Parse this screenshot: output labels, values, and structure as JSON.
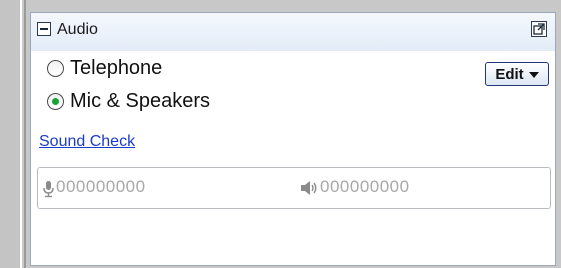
{
  "panel": {
    "title": "Audio",
    "collapse_icon": "minus-box-icon",
    "popout_icon": "popout-icon"
  },
  "audio_options": {
    "telephone_label": "Telephone",
    "mic_speakers_label": "Mic & Speakers",
    "selected": "Mic & Speakers"
  },
  "edit_button": {
    "label": "Edit",
    "icon": "dropdown-arrow-icon"
  },
  "sound_check": {
    "label": "Sound Check"
  },
  "levels": {
    "mic_meter": "000000000",
    "speaker_meter": "000000000",
    "mic_icon": "microphone-icon",
    "speaker_icon": "speaker-icon"
  },
  "colors": {
    "link": "#1a3ccc",
    "radio_selected": "#17a336",
    "meter_inactive": "#a8a8a8",
    "header_bg": "#e3ecf7"
  }
}
